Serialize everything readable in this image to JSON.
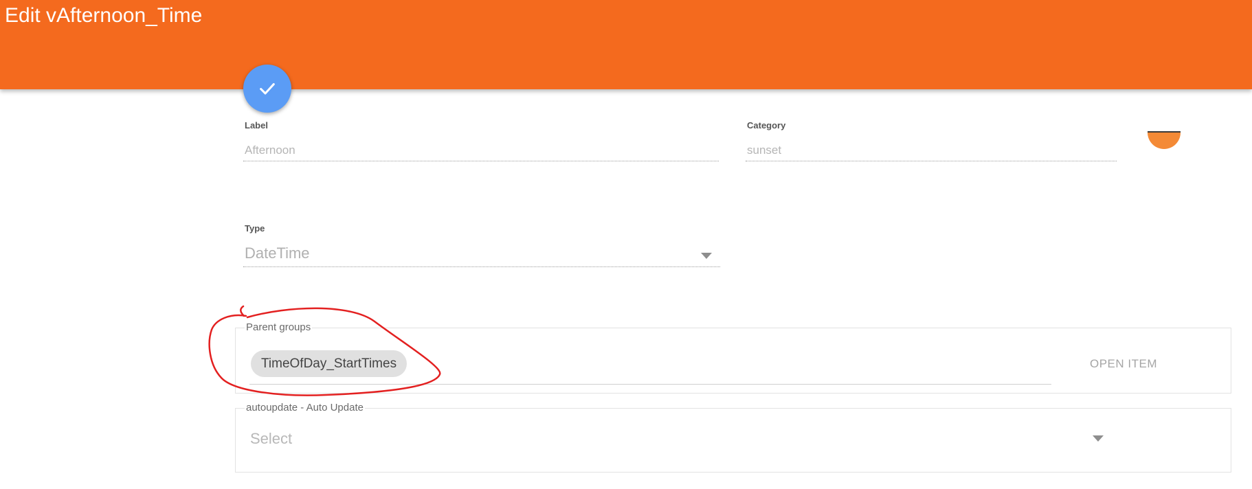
{
  "header": {
    "title": "Edit vAfternoon_Time"
  },
  "save_fab": {
    "icon": "check-icon"
  },
  "form": {
    "label": {
      "caption": "Label",
      "value": "Afternoon"
    },
    "category": {
      "caption": "Category",
      "value": "sunset"
    },
    "type": {
      "caption": "Type",
      "value": "DateTime"
    },
    "parent_groups": {
      "legend": "Parent groups",
      "chips": [
        "TimeOfDay_StartTimes"
      ],
      "open_item_label": "OPEN ITEM"
    },
    "autoupdate": {
      "legend": "autoupdate - Auto Update",
      "placeholder": "Select"
    }
  },
  "colors": {
    "header_bg": "#f46a1e",
    "fab_bg": "#5b9cf5",
    "annotation_stroke": "#e32020"
  }
}
